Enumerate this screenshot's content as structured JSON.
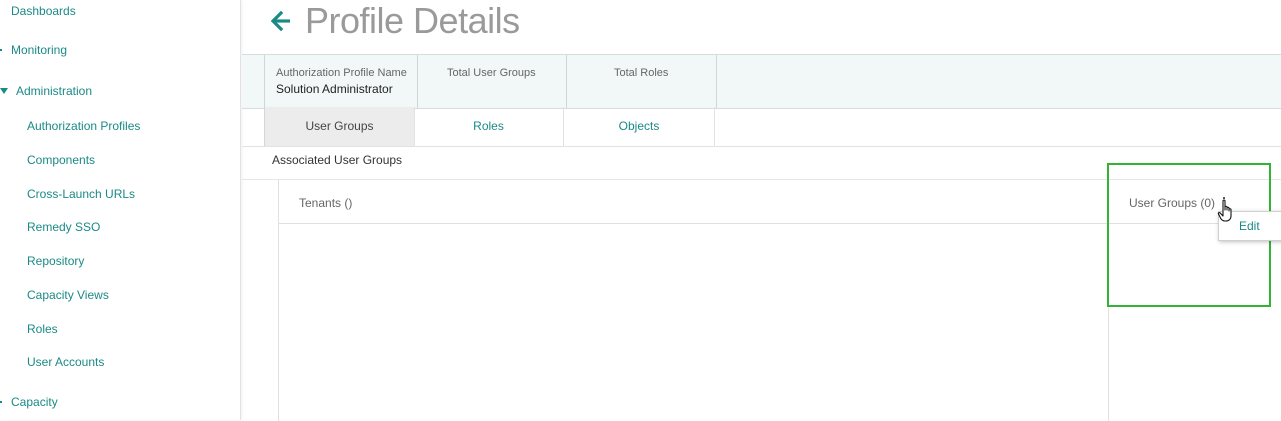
{
  "sidebar": {
    "top_items": [
      {
        "label": "Dashboards"
      },
      {
        "label": "Monitoring"
      },
      {
        "label": "Administration"
      },
      {
        "label": "Capacity"
      }
    ],
    "admin_items": [
      {
        "label": "Authorization Profiles"
      },
      {
        "label": "Components"
      },
      {
        "label": "Cross-Launch URLs"
      },
      {
        "label": "Remedy SSO"
      },
      {
        "label": "Repository"
      },
      {
        "label": "Capacity Views"
      },
      {
        "label": "Roles"
      },
      {
        "label": "User Accounts"
      }
    ]
  },
  "header": {
    "title": "Profile Details",
    "back_icon": "arrow-left-icon"
  },
  "summary": {
    "profile_name_label": "Authorization Profile Name",
    "profile_name_value": "Solution Administrator",
    "total_user_groups_label": "Total User Groups",
    "total_roles_label": "Total Roles"
  },
  "tabs": [
    {
      "label": "User Groups",
      "active": true
    },
    {
      "label": "Roles",
      "active": false
    },
    {
      "label": "Objects",
      "active": false
    }
  ],
  "section": {
    "title": "Associated User Groups",
    "tenants_header": "Tenants ()",
    "user_groups_header": "User Groups (0)"
  },
  "context_menu": {
    "items": [
      {
        "label": "Edit"
      }
    ]
  },
  "colors": {
    "accent": "#1a8a86",
    "highlight": "#34b233",
    "title_gray": "#9a9a9a"
  }
}
